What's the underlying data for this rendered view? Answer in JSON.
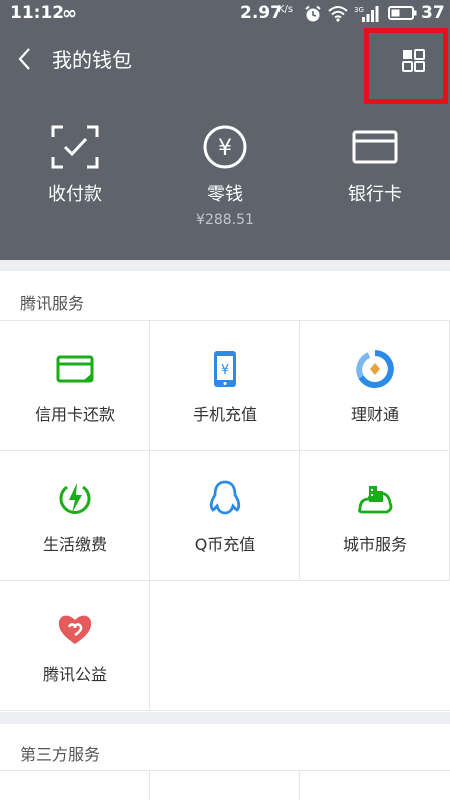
{
  "status_bar": {
    "time": "11:12",
    "infinity": "∞",
    "speed": "2.97",
    "speed_unit": "K/s",
    "battery": "37"
  },
  "header": {
    "title": "我的钱包",
    "back_icon": "chevron-left-icon",
    "grid_icon": "grid-icon",
    "highlight_color": "#e5101a",
    "background": "#5f636b"
  },
  "top_actions": [
    {
      "label": "收付款",
      "icon": "scan-pay-icon"
    },
    {
      "label": "零钱",
      "icon": "yuan-coin-icon",
      "sub": "¥288.51"
    },
    {
      "label": "银行卡",
      "icon": "bank-card-icon"
    }
  ],
  "sections": [
    {
      "title": "腾讯服务",
      "items": [
        {
          "label": "信用卡还款",
          "icon": "credit-card-icon"
        },
        {
          "label": "手机充值",
          "icon": "phone-recharge-icon"
        },
        {
          "label": "理财通",
          "icon": "wealth-icon"
        },
        {
          "label": "生活缴费",
          "icon": "utility-bolt-icon"
        },
        {
          "label": "Q币充值",
          "icon": "qq-penguin-icon"
        },
        {
          "label": "城市服务",
          "icon": "city-icon"
        },
        {
          "label": "腾讯公益",
          "icon": "charity-heart-icon"
        }
      ]
    },
    {
      "title": "第三方服务"
    }
  ]
}
